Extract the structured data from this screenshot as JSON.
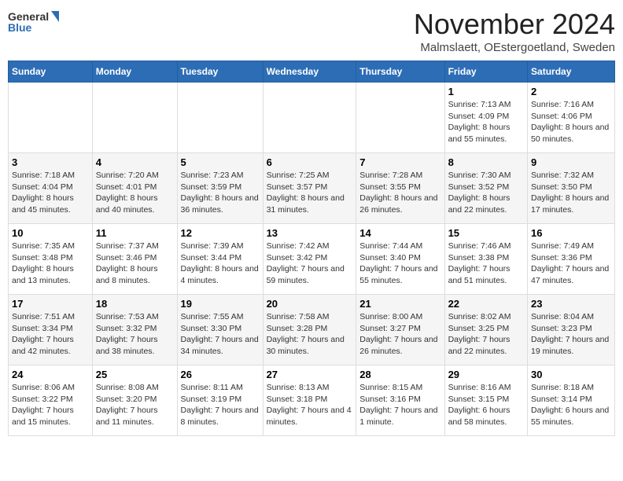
{
  "header": {
    "logo": {
      "general": "General",
      "blue": "Blue"
    },
    "title": "November 2024",
    "subtitle": "Malmslaett, OEstergoetland, Sweden"
  },
  "weekdays": [
    "Sunday",
    "Monday",
    "Tuesday",
    "Wednesday",
    "Thursday",
    "Friday",
    "Saturday"
  ],
  "weeks": [
    [
      {
        "day": "",
        "info": ""
      },
      {
        "day": "",
        "info": ""
      },
      {
        "day": "",
        "info": ""
      },
      {
        "day": "",
        "info": ""
      },
      {
        "day": "",
        "info": ""
      },
      {
        "day": "1",
        "info": "Sunrise: 7:13 AM\nSunset: 4:09 PM\nDaylight: 8 hours and 55 minutes."
      },
      {
        "day": "2",
        "info": "Sunrise: 7:16 AM\nSunset: 4:06 PM\nDaylight: 8 hours and 50 minutes."
      }
    ],
    [
      {
        "day": "3",
        "info": "Sunrise: 7:18 AM\nSunset: 4:04 PM\nDaylight: 8 hours and 45 minutes."
      },
      {
        "day": "4",
        "info": "Sunrise: 7:20 AM\nSunset: 4:01 PM\nDaylight: 8 hours and 40 minutes."
      },
      {
        "day": "5",
        "info": "Sunrise: 7:23 AM\nSunset: 3:59 PM\nDaylight: 8 hours and 36 minutes."
      },
      {
        "day": "6",
        "info": "Sunrise: 7:25 AM\nSunset: 3:57 PM\nDaylight: 8 hours and 31 minutes."
      },
      {
        "day": "7",
        "info": "Sunrise: 7:28 AM\nSunset: 3:55 PM\nDaylight: 8 hours and 26 minutes."
      },
      {
        "day": "8",
        "info": "Sunrise: 7:30 AM\nSunset: 3:52 PM\nDaylight: 8 hours and 22 minutes."
      },
      {
        "day": "9",
        "info": "Sunrise: 7:32 AM\nSunset: 3:50 PM\nDaylight: 8 hours and 17 minutes."
      }
    ],
    [
      {
        "day": "10",
        "info": "Sunrise: 7:35 AM\nSunset: 3:48 PM\nDaylight: 8 hours and 13 minutes."
      },
      {
        "day": "11",
        "info": "Sunrise: 7:37 AM\nSunset: 3:46 PM\nDaylight: 8 hours and 8 minutes."
      },
      {
        "day": "12",
        "info": "Sunrise: 7:39 AM\nSunset: 3:44 PM\nDaylight: 8 hours and 4 minutes."
      },
      {
        "day": "13",
        "info": "Sunrise: 7:42 AM\nSunset: 3:42 PM\nDaylight: 7 hours and 59 minutes."
      },
      {
        "day": "14",
        "info": "Sunrise: 7:44 AM\nSunset: 3:40 PM\nDaylight: 7 hours and 55 minutes."
      },
      {
        "day": "15",
        "info": "Sunrise: 7:46 AM\nSunset: 3:38 PM\nDaylight: 7 hours and 51 minutes."
      },
      {
        "day": "16",
        "info": "Sunrise: 7:49 AM\nSunset: 3:36 PM\nDaylight: 7 hours and 47 minutes."
      }
    ],
    [
      {
        "day": "17",
        "info": "Sunrise: 7:51 AM\nSunset: 3:34 PM\nDaylight: 7 hours and 42 minutes."
      },
      {
        "day": "18",
        "info": "Sunrise: 7:53 AM\nSunset: 3:32 PM\nDaylight: 7 hours and 38 minutes."
      },
      {
        "day": "19",
        "info": "Sunrise: 7:55 AM\nSunset: 3:30 PM\nDaylight: 7 hours and 34 minutes."
      },
      {
        "day": "20",
        "info": "Sunrise: 7:58 AM\nSunset: 3:28 PM\nDaylight: 7 hours and 30 minutes."
      },
      {
        "day": "21",
        "info": "Sunrise: 8:00 AM\nSunset: 3:27 PM\nDaylight: 7 hours and 26 minutes."
      },
      {
        "day": "22",
        "info": "Sunrise: 8:02 AM\nSunset: 3:25 PM\nDaylight: 7 hours and 22 minutes."
      },
      {
        "day": "23",
        "info": "Sunrise: 8:04 AM\nSunset: 3:23 PM\nDaylight: 7 hours and 19 minutes."
      }
    ],
    [
      {
        "day": "24",
        "info": "Sunrise: 8:06 AM\nSunset: 3:22 PM\nDaylight: 7 hours and 15 minutes."
      },
      {
        "day": "25",
        "info": "Sunrise: 8:08 AM\nSunset: 3:20 PM\nDaylight: 7 hours and 11 minutes."
      },
      {
        "day": "26",
        "info": "Sunrise: 8:11 AM\nSunset: 3:19 PM\nDaylight: 7 hours and 8 minutes."
      },
      {
        "day": "27",
        "info": "Sunrise: 8:13 AM\nSunset: 3:18 PM\nDaylight: 7 hours and 4 minutes."
      },
      {
        "day": "28",
        "info": "Sunrise: 8:15 AM\nSunset: 3:16 PM\nDaylight: 7 hours and 1 minute."
      },
      {
        "day": "29",
        "info": "Sunrise: 8:16 AM\nSunset: 3:15 PM\nDaylight: 6 hours and 58 minutes."
      },
      {
        "day": "30",
        "info": "Sunrise: 8:18 AM\nSunset: 3:14 PM\nDaylight: 6 hours and 55 minutes."
      }
    ]
  ]
}
